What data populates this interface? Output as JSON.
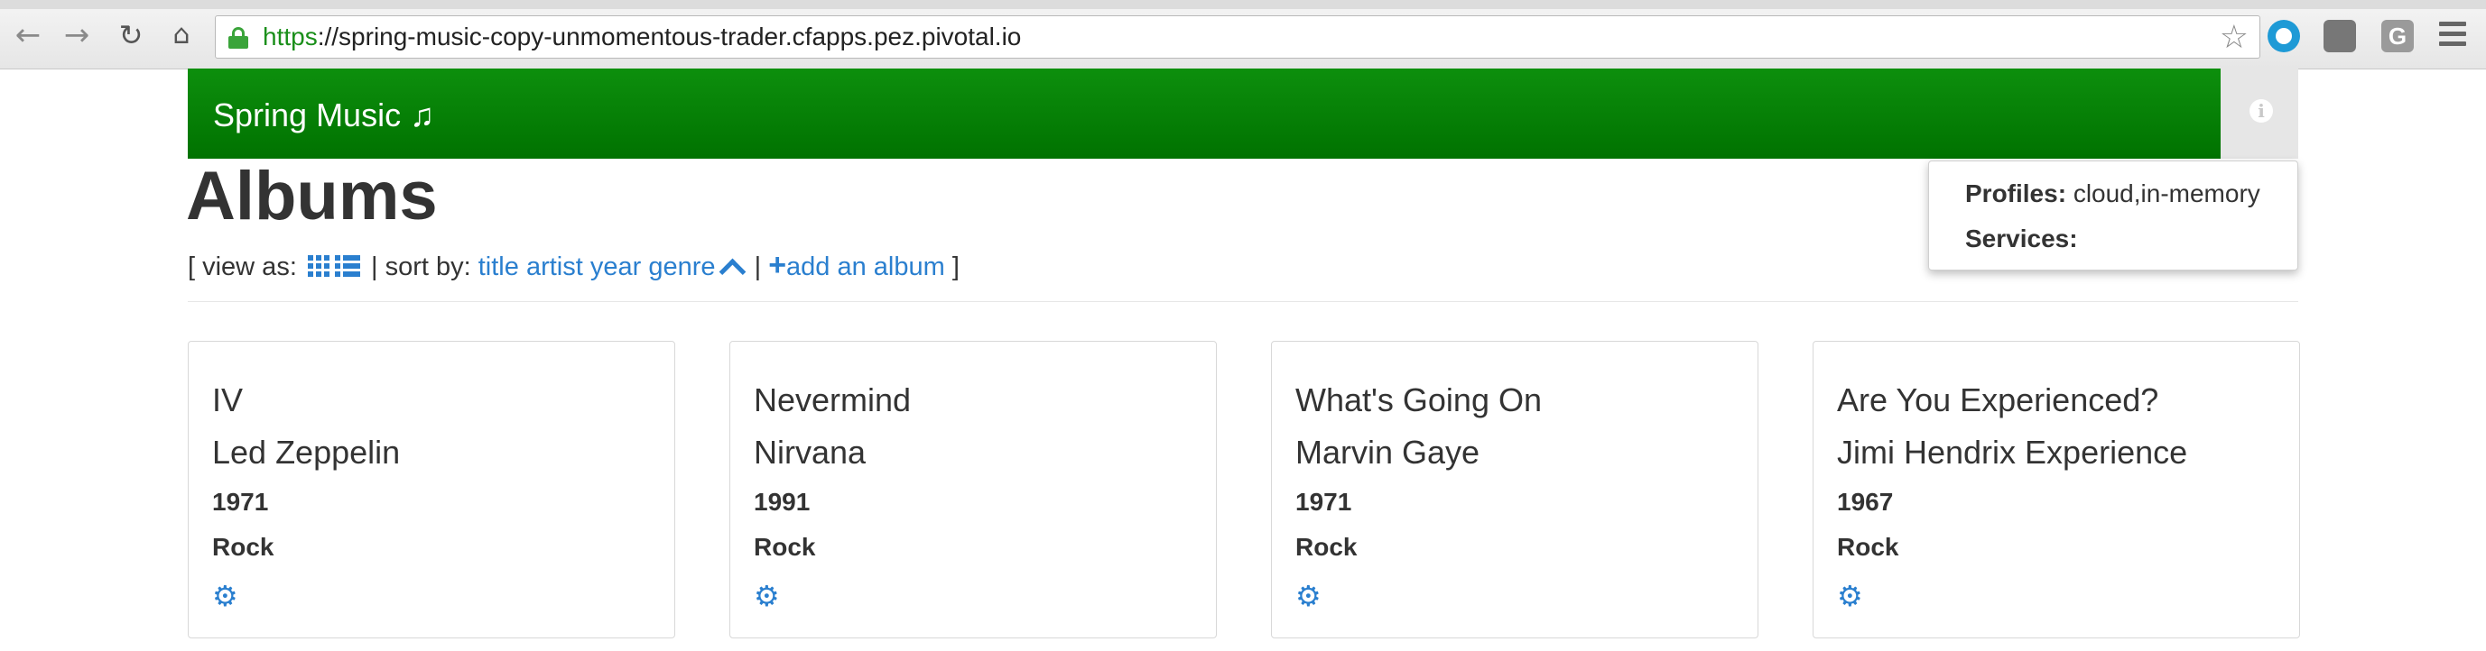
{
  "browser": {
    "url_scheme": "https",
    "url_rest": "://spring-music-copy-unmomentous-trader.cfapps.pez.pivotal.io",
    "icons": [
      "back-arrow",
      "forward-arrow",
      "reload",
      "home",
      "lock",
      "star",
      "extension-circle",
      "extension-box",
      "extension-g",
      "menu"
    ],
    "ext3_label": "G"
  },
  "header": {
    "brand": "Spring Music",
    "brand_icon": "♫",
    "info_icon": "i",
    "colors": {
      "bar": "#008000",
      "link": "#2a7fcf"
    }
  },
  "popover": {
    "profiles_label": "Profiles:",
    "profiles_value": "cloud,in-memory",
    "services_label": "Services:",
    "services_value": ""
  },
  "page": {
    "title": "Albums",
    "toolbar": {
      "open_bracket": "[ view as:",
      "sep1": "| sort by:",
      "sort_title": "title",
      "sort_artist": "artist",
      "sort_year": "year",
      "sort_genre": "genre",
      "sep2": "|",
      "add_album": "add an album",
      "close_bracket": "]"
    }
  },
  "albums": [
    {
      "title": "IV",
      "artist": "Led Zeppelin",
      "year": "1971",
      "genre": "Rock"
    },
    {
      "title": "Nevermind",
      "artist": "Nirvana",
      "year": "1991",
      "genre": "Rock"
    },
    {
      "title": "What's Going On",
      "artist": "Marvin Gaye",
      "year": "1971",
      "genre": "Rock"
    },
    {
      "title": "Are You Experienced?",
      "artist": "Jimi Hendrix Experience",
      "year": "1967",
      "genre": "Rock"
    }
  ]
}
